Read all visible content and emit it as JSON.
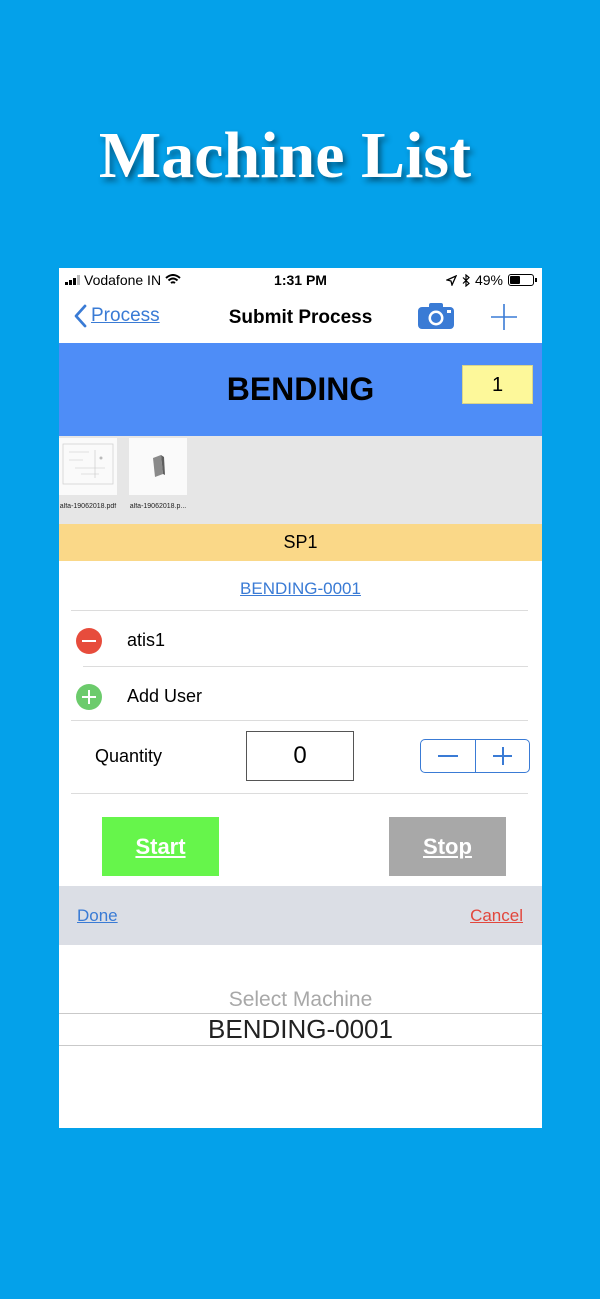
{
  "headline": "Machine List",
  "status_bar": {
    "carrier": "Vodafone IN",
    "time": "1:31 PM",
    "battery": "49%",
    "battery_level": 0.49
  },
  "navbar": {
    "back_label": "Process",
    "title": "Submit Process",
    "camera_icon": "camera-icon",
    "add_icon": "plus-icon"
  },
  "banner": {
    "title": "BENDING",
    "count": "1"
  },
  "documents": [
    {
      "name": "alfa-19062018.pdf"
    },
    {
      "name": "alfa-19062018.p..."
    }
  ],
  "section": {
    "label": "SP1",
    "machine_link": "BENDING-0001"
  },
  "users": [
    {
      "name": "atis1",
      "action": "remove"
    }
  ],
  "add_user_label": "Add User",
  "quantity": {
    "label": "Quantity",
    "value": "0"
  },
  "actions": {
    "start_label": "Start",
    "stop_label": "Stop"
  },
  "picker": {
    "done_label": "Done",
    "cancel_label": "Cancel",
    "title": "Select Machine",
    "selected": "BENDING-0001"
  },
  "colors": {
    "background": "#04a1ea",
    "banner": "#4e8df7",
    "count_box": "#fdf89a",
    "section_bar": "#fad888",
    "start_button": "#66f54b",
    "stop_button": "#a8a8a8",
    "remove_icon": "#e74c3c",
    "add_icon": "#6ccb6c",
    "link": "#3a7bd5",
    "cancel": "#e2463c"
  }
}
